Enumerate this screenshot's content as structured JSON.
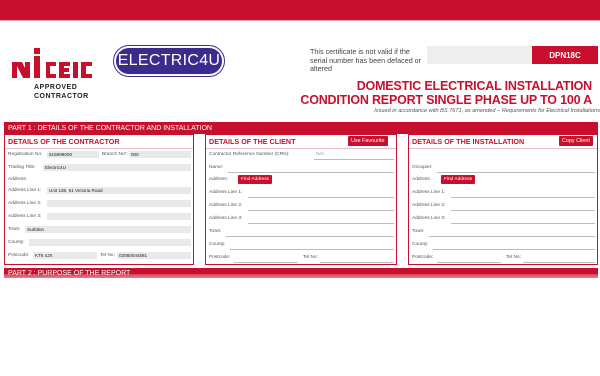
{
  "header": {
    "approved_line1": "APPROVED",
    "approved_line2": "CONTRACTOR",
    "brand": "ELECTRIC4U",
    "notice": "This certificate is not valid if the serial number has been defaced or altered",
    "cert_code": "DPN18C",
    "title_line1": "DOMESTIC ELECTRICAL INSTALLATION",
    "title_line2": "CONDITION REPORT SINGLE PHASE UP TO 100 A",
    "subtitle": "Issued in accordance with BS 7671, as amended – Requirements for Electrical Installations",
    "colors": {
      "accent": "#c8102e",
      "brand_pill": "#3a2b8c"
    }
  },
  "part1": {
    "title": "PART 1 : DETAILS OF THE CONTRACTOR AND INSTALLATION"
  },
  "part2": {
    "title": "PART 2 : PURPOSE OF THE REPORT"
  },
  "contractor": {
    "heading": "DETAILS OF THE CONTRACTOR",
    "registration_label": "Registration No:",
    "registration_value": "615898000",
    "branch_label": "Branch No*:",
    "branch_value": "000",
    "trading_label": "Trading Title:",
    "trading_value": "Electric4U",
    "address_label": "Address:",
    "line1_label": "Address Line 1:",
    "line1_value": "Unit 138, 61 Victoria Road",
    "line2_label": "Address Line 2:",
    "line3_label": "Address Line 3:",
    "town_label": "Town:",
    "town_value": "Surbiton",
    "county_label": "County:",
    "postcode_label": "Postcode:",
    "postcode_value": "KT6 4JX",
    "tel_label": "Tel No:",
    "tel_value": "02080044581"
  },
  "client": {
    "heading": "DETAILS OF THE CLIENT",
    "use_favourite": "Use Favourite",
    "crn_label": "Contractor Reference Number (CRN):",
    "crn_value": "N/A",
    "name_label": "Name:",
    "address_label": "Address:",
    "find_address": "Find Address",
    "line1_label": "Address Line 1:",
    "line2_label": "Address Line 2:",
    "line3_label": "Address Line 3:",
    "town_label": "Town:",
    "county_label": "County:",
    "postcode_label": "Postcode:",
    "tel_label": "Tel No:"
  },
  "installation": {
    "heading": "DETAILS OF THE INSTALLATION",
    "copy_client": "Copy Client",
    "occupier_label": "Occupier:",
    "address_label": "Address:",
    "find_address": "Find Address",
    "line1_label": "Address Line 1:",
    "line2_label": "Address Line 2:",
    "line3_label": "Address Line 3:",
    "town_label": "Town:",
    "county_label": "County:",
    "postcode_label": "Postcode:",
    "tel_label": "Tel No:"
  }
}
